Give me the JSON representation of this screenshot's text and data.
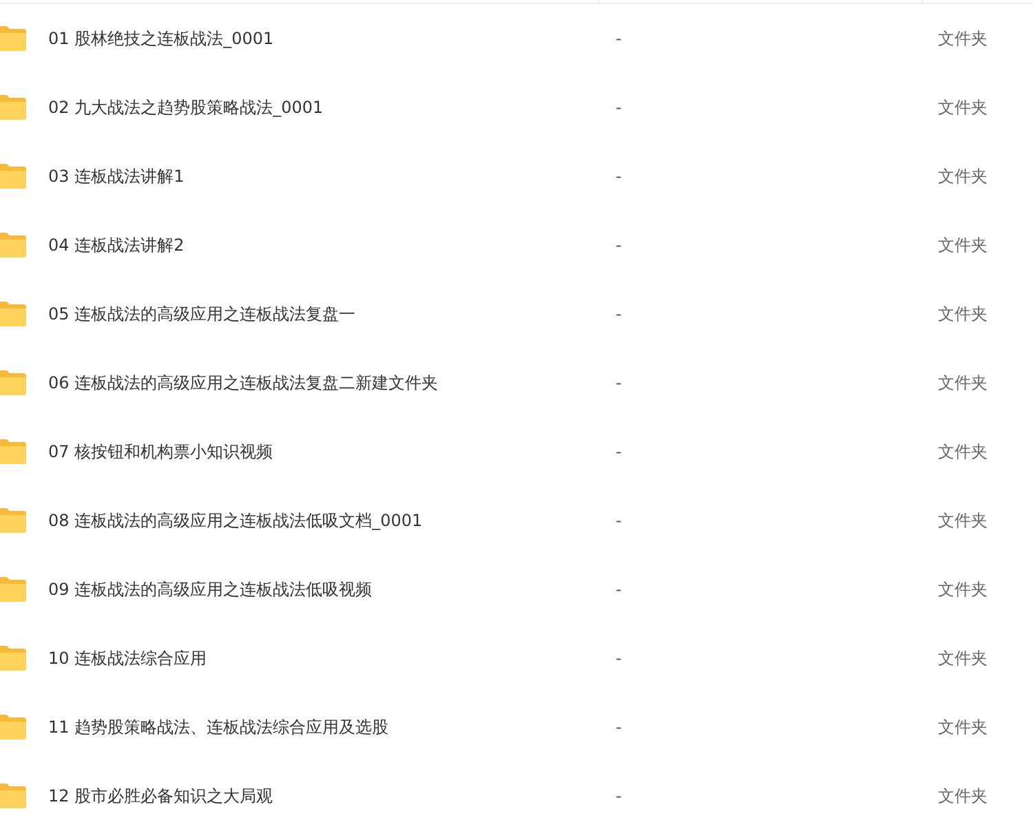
{
  "files": [
    {
      "name": "01 股林绝技之连板战法_0001",
      "size": "-",
      "type": "文件夹"
    },
    {
      "name": "02 九大战法之趋势股策略战法_0001",
      "size": "-",
      "type": "文件夹"
    },
    {
      "name": "03 连板战法讲解1",
      "size": "-",
      "type": "文件夹"
    },
    {
      "name": "04 连板战法讲解2",
      "size": "-",
      "type": "文件夹"
    },
    {
      "name": "05 连板战法的高级应用之连板战法复盘一",
      "size": "-",
      "type": "文件夹"
    },
    {
      "name": "06 连板战法的高级应用之连板战法复盘二新建文件夹",
      "size": "-",
      "type": "文件夹"
    },
    {
      "name": "07 核按钮和机构票小知识视频",
      "size": "-",
      "type": "文件夹"
    },
    {
      "name": "08 连板战法的高级应用之连板战法低吸文档_0001",
      "size": "-",
      "type": "文件夹"
    },
    {
      "name": "09 连板战法的高级应用之连板战法低吸视频",
      "size": "-",
      "type": "文件夹"
    },
    {
      "name": "10 连板战法综合应用",
      "size": "-",
      "type": "文件夹"
    },
    {
      "name": "11 趋势股策略战法、连板战法综合应用及选股",
      "size": "-",
      "type": "文件夹"
    },
    {
      "name": "12 股市必胜必备知识之大局观",
      "size": "-",
      "type": "文件夹"
    }
  ]
}
